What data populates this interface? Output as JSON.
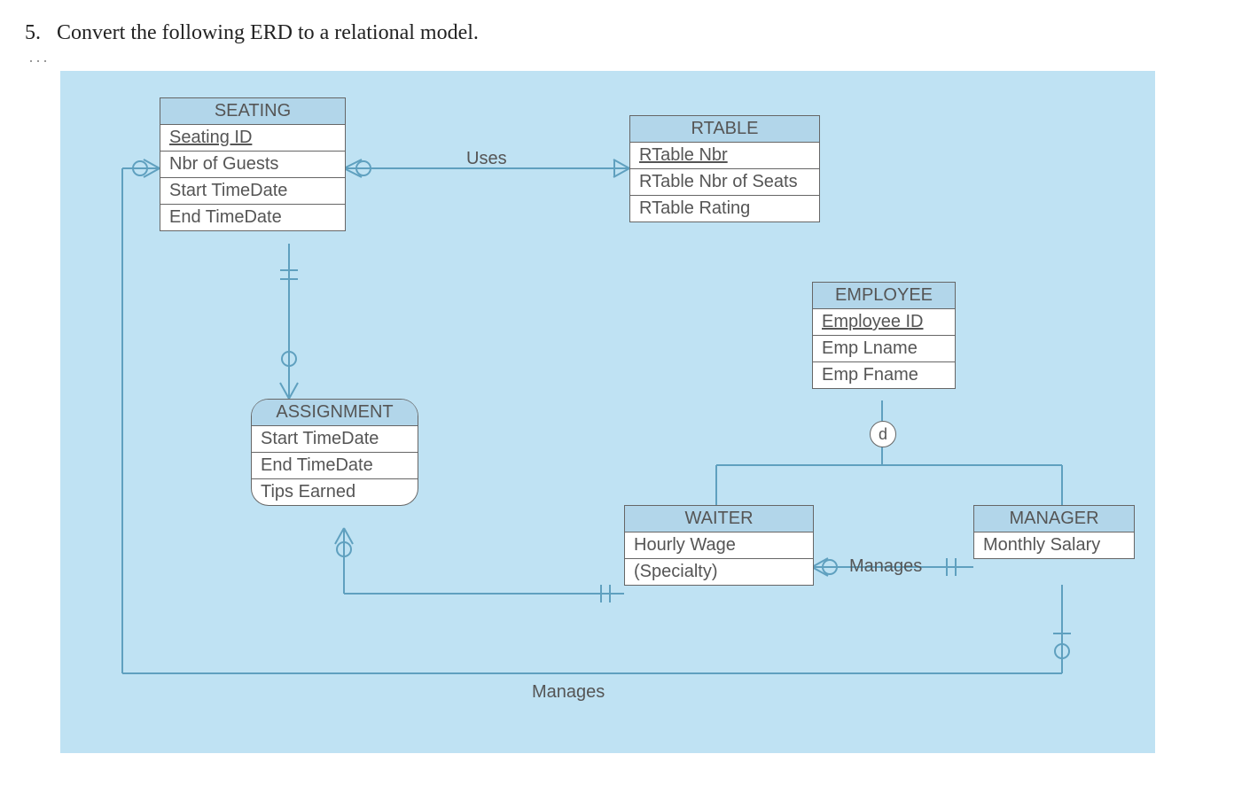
{
  "question": {
    "number": "5.",
    "text": "Convert the following ERD to a relational model."
  },
  "entities": {
    "seating": {
      "title": "SEATING",
      "attrs": [
        "Seating ID",
        "Nbr of Guests",
        "Start TimeDate",
        "End TimeDate"
      ]
    },
    "rtable": {
      "title": "RTABLE",
      "attrs": [
        "RTable Nbr",
        "RTable Nbr of Seats",
        "RTable Rating"
      ]
    },
    "employee": {
      "title": "EMPLOYEE",
      "attrs": [
        "Employee ID",
        "Emp Lname",
        "Emp Fname"
      ]
    },
    "assignment": {
      "title": "ASSIGNMENT",
      "attrs": [
        "Start TimeDate",
        "End TimeDate",
        "Tips Earned"
      ]
    },
    "waiter": {
      "title": "WAITER",
      "attrs": [
        "Hourly Wage",
        "(Specialty)"
      ]
    },
    "manager": {
      "title": "MANAGER",
      "attrs": [
        "Monthly Salary"
      ]
    }
  },
  "relationships": {
    "uses": "Uses",
    "manages1": "Manages",
    "manages2": "Manages"
  },
  "disjoint_symbol": "d"
}
